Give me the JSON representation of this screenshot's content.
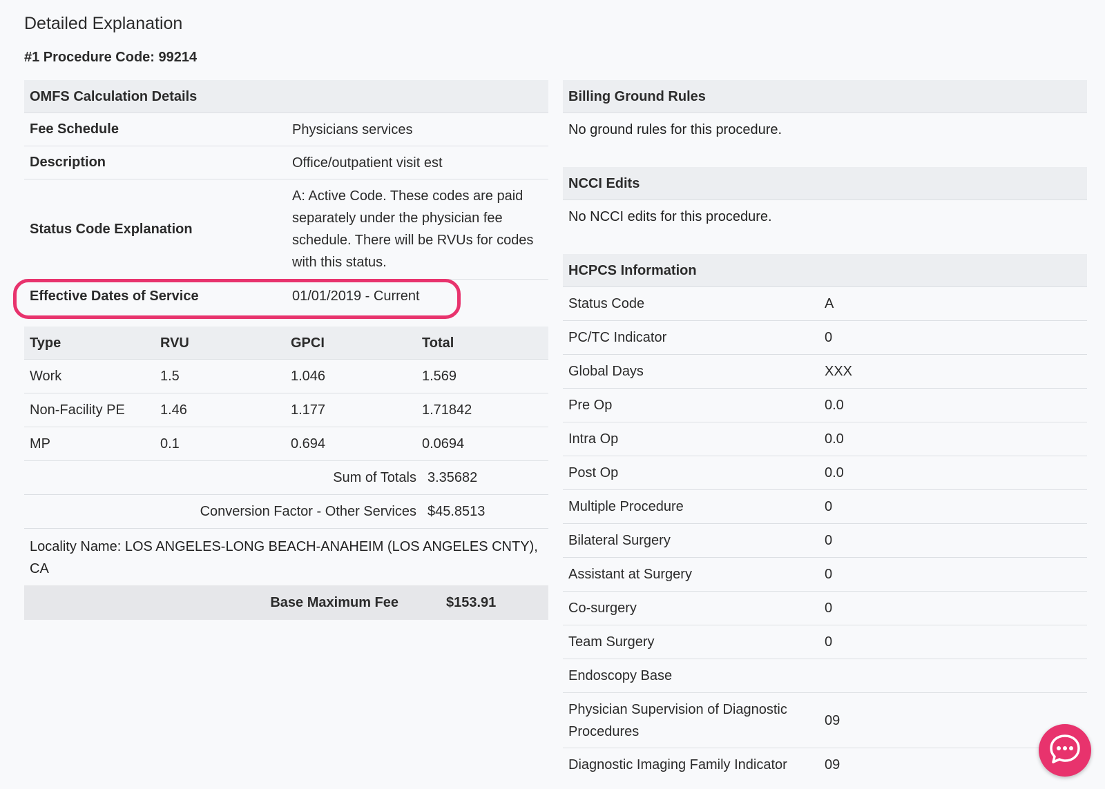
{
  "page": {
    "title": "Detailed Explanation",
    "procedure_heading": "#1 Procedure Code: 99214"
  },
  "omfs": {
    "heading": "OMFS Calculation Details",
    "rows": [
      {
        "key": "Fee Schedule",
        "value": "Physicians services"
      },
      {
        "key": "Description",
        "value": "Office/outpatient visit est"
      },
      {
        "key": "Status Code Explanation",
        "value": "A: Active Code. These codes are paid separately under the physician fee schedule. There will be RVUs for codes with this status."
      },
      {
        "key": "Effective Dates of Service",
        "value": "01/01/2019 - Current"
      }
    ]
  },
  "rvu_table": {
    "headers": [
      "Type",
      "RVU",
      "GPCI",
      "Total"
    ],
    "rows": [
      [
        "Work",
        "1.5",
        "1.046",
        "1.569"
      ],
      [
        "Non-Facility PE",
        "1.46",
        "1.177",
        "1.71842"
      ],
      [
        "MP",
        "0.1",
        "0.694",
        "0.0694"
      ]
    ],
    "sum_label": "Sum of Totals",
    "sum_value": "3.35682",
    "cf_label": "Conversion Factor - Other Services",
    "cf_value": "$45.8513",
    "locality": "Locality Name: LOS ANGELES-LONG BEACH-ANAHEIM (LOS ANGELES CNTY), CA",
    "base_fee_label": "Base Maximum Fee",
    "base_fee_value": "$153.91"
  },
  "billing": {
    "heading": "Billing Ground Rules",
    "text": "No ground rules for this procedure."
  },
  "ncci": {
    "heading": "NCCI Edits",
    "text": "No NCCI edits for this procedure."
  },
  "hcpcs": {
    "heading": "HCPCS Information",
    "rows": [
      {
        "key": "Status Code",
        "value": "A"
      },
      {
        "key": "PC/TC Indicator",
        "value": "0"
      },
      {
        "key": "Global Days",
        "value": "XXX"
      },
      {
        "key": "Pre Op",
        "value": "0.0"
      },
      {
        "key": "Intra Op",
        "value": "0.0"
      },
      {
        "key": "Post Op",
        "value": "0.0"
      },
      {
        "key": "Multiple Procedure",
        "value": "0"
      },
      {
        "key": "Bilateral Surgery",
        "value": "0"
      },
      {
        "key": "Assistant at Surgery",
        "value": "0"
      },
      {
        "key": "Co-surgery",
        "value": "0"
      },
      {
        "key": "Team Surgery",
        "value": "0"
      },
      {
        "key": "Endoscopy Base",
        "value": ""
      },
      {
        "key": "Physician Supervision of Diagnostic Procedures",
        "value": "09"
      },
      {
        "key": "Diagnostic Imaging Family Indicator",
        "value": "09"
      }
    ]
  },
  "chat": {
    "icon": "chat-bubble-icon",
    "color": "#e8336d"
  }
}
